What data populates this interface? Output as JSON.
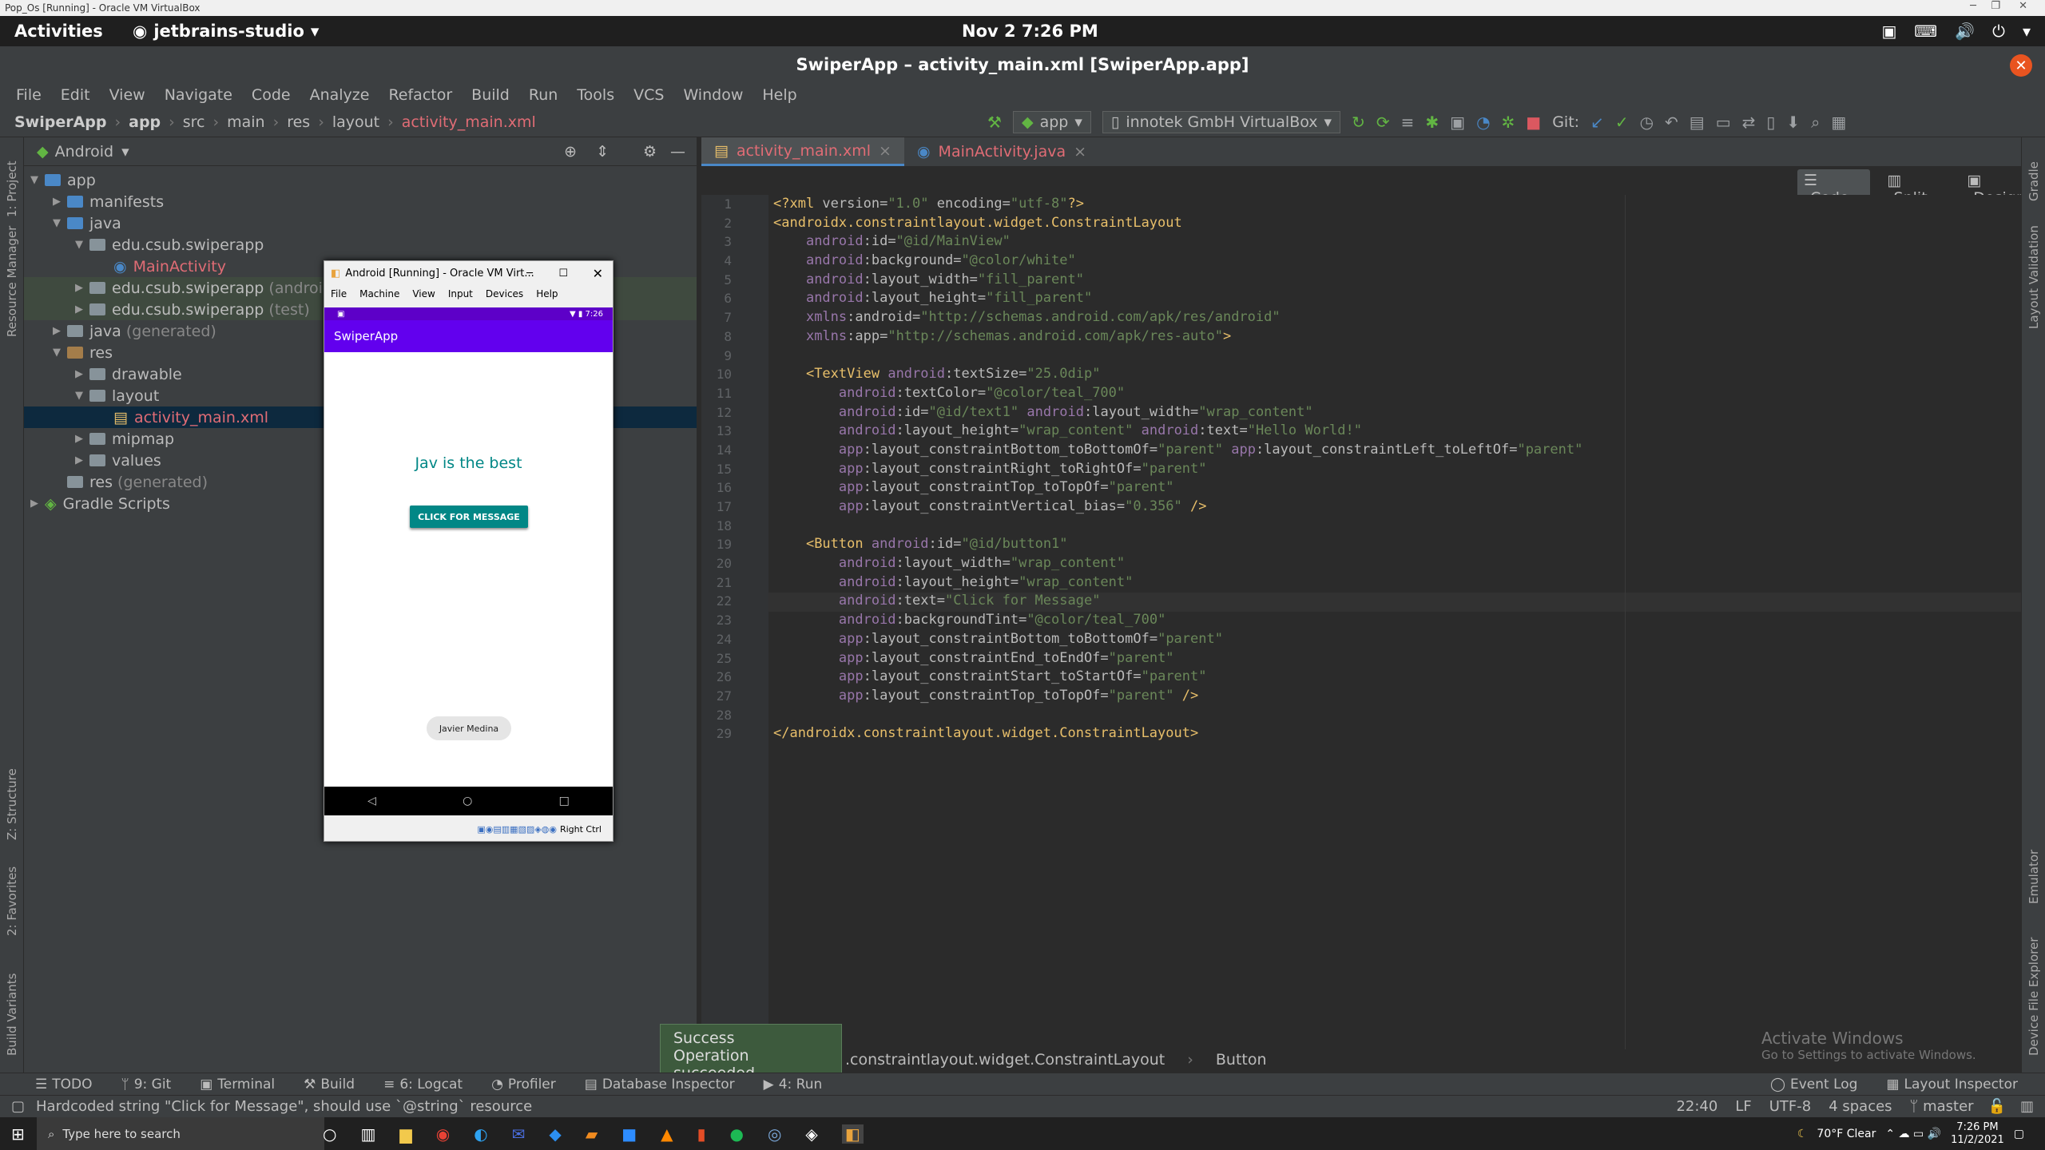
{
  "vbox": {
    "title": "Pop_Os [Running] - Oracle VM VirtualBox"
  },
  "topbar": {
    "activities": "Activities",
    "app": "jetbrains-studio",
    "clock": "Nov 2  7:26 PM"
  },
  "ide": {
    "title": "SwiperApp – activity_main.xml [SwiperApp.app]"
  },
  "menu": [
    "File",
    "Edit",
    "View",
    "Navigate",
    "Code",
    "Analyze",
    "Refactor",
    "Build",
    "Run",
    "Tools",
    "VCS",
    "Window",
    "Help"
  ],
  "breadcrumb": [
    "SwiperApp",
    "app",
    "src",
    "main",
    "res",
    "layout",
    "activity_main.xml"
  ],
  "toolbar": {
    "config": "app",
    "device": "innotek GmbH VirtualBox",
    "git": "Git:"
  },
  "leftstrip": [
    "1: Project",
    "Resource Manager",
    "Z: Structure",
    "2: Favorites",
    "Build Variants"
  ],
  "rightstrip": [
    "Gradle",
    "Layout Validation",
    "Emulator",
    "Device File Explorer"
  ],
  "project": {
    "view": "Android",
    "tree": [
      {
        "label": "app",
        "depth": 0
      },
      {
        "label": "manifests",
        "depth": 1
      },
      {
        "label": "java",
        "depth": 1
      },
      {
        "label": "edu.csub.swiperapp",
        "depth": 2
      },
      {
        "label": "MainActivity",
        "depth": 3
      },
      {
        "label": "edu.csub.swiperapp",
        "suffix": "(androidTest)",
        "depth": 2
      },
      {
        "label": "edu.csub.swiperapp",
        "suffix": "(test)",
        "depth": 2
      },
      {
        "label": "java",
        "suffix": "(generated)",
        "depth": 1
      },
      {
        "label": "res",
        "depth": 1
      },
      {
        "label": "drawable",
        "depth": 2
      },
      {
        "label": "layout",
        "depth": 2
      },
      {
        "label": "activity_main.xml",
        "depth": 3
      },
      {
        "label": "mipmap",
        "depth": 2
      },
      {
        "label": "values",
        "depth": 2
      },
      {
        "label": "res",
        "suffix": "(generated)",
        "depth": 1
      },
      {
        "label": "Gradle Scripts",
        "depth": 0
      }
    ]
  },
  "vm": {
    "title": "Android [Running] - Oracle VM Virt...",
    "menu": [
      "File",
      "Machine",
      "View",
      "Input",
      "Devices",
      "Help"
    ],
    "time": "7:26",
    "app_title": "SwiperApp",
    "text": "Jav is the best",
    "button": "CLICK FOR MESSAGE",
    "chip": "Javier Medina",
    "host_key": "Right Ctrl"
  },
  "tabs": [
    {
      "label": "activity_main.xml"
    },
    {
      "label": "MainActivity.java"
    }
  ],
  "modes": [
    "Code",
    "Split",
    "Design"
  ],
  "lines": [
    "1",
    "2",
    "3",
    "4",
    "5",
    "6",
    "7",
    "8",
    "9",
    "10",
    "11",
    "12",
    "13",
    "14",
    "15",
    "16",
    "17",
    "18",
    "19",
    "20",
    "21",
    "22",
    "23",
    "24",
    "25",
    "26",
    "27",
    "28",
    "29"
  ],
  "code": [
    "<?xml version=\"1.0\" encoding=\"utf-8\"?>",
    "<androidx.constraintlayout.widget.ConstraintLayout",
    "    android:id=\"@id/MainView\"",
    "    android:background=\"@color/white\"",
    "    android:layout_width=\"fill_parent\"",
    "    android:layout_height=\"fill_parent\"",
    "    xmlns:android=\"http://schemas.android.com/apk/res/android\"",
    "    xmlns:app=\"http://schemas.android.com/apk/res-auto\">",
    "",
    "    <TextView android:textSize=\"25.0dip\"",
    "        android:textColor=\"@color/teal_700\"",
    "        android:id=\"@id/text1\" android:layout_width=\"wrap_content\"",
    "        android:layout_height=\"wrap_content\" android:text=\"Hello World!\"",
    "        app:layout_constraintBottom_toBottomOf=\"parent\" app:layout_constraintLeft_toLeftOf=\"parent\"",
    "        app:layout_constraintRight_toRightOf=\"parent\"",
    "        app:layout_constraintTop_toTopOf=\"parent\"",
    "        app:layout_constraintVertical_bias=\"0.356\" />",
    "",
    "    <Button android:id=\"@id/button1\"",
    "        android:layout_width=\"wrap_content\"",
    "        android:layout_height=\"wrap_content\"",
    "        android:text=\"Click for Message\"",
    "        android:backgroundTint=\"@color/teal_700\"",
    "        app:layout_constraintBottom_toBottomOf=\"parent\"",
    "        app:layout_constraintEnd_toEndOf=\"parent\"",
    "        app:layout_constraintStart_toStartOf=\"parent\"",
    "        app:layout_constraintTop_toTopOf=\"parent\" />",
    "",
    "</androidx.constraintlayout.widget.ConstraintLayout>"
  ],
  "editor_crumb": [
    ".constraintlayout.widget.ConstraintLayout",
    "Button"
  ],
  "toast": {
    "title": "Success",
    "msg": "Operation succeeded"
  },
  "watermark": {
    "title": "Activate Windows",
    "sub": "Go to Settings to activate Windows."
  },
  "bottomtabs": [
    "TODO",
    "9: Git",
    "Terminal",
    "Build",
    "6: Logcat",
    "Profiler",
    "Database Inspector",
    "4: Run"
  ],
  "bottomright": [
    "Event Log",
    "Layout Inspector"
  ],
  "status": {
    "message": "Hardcoded string \"Click for Message\", should use `@string` resource",
    "pos": "22:40",
    "lf": "LF",
    "enc": "UTF-8",
    "indent": "4 spaces",
    "branch": "master"
  },
  "taskbar": {
    "search": "Type here to search",
    "weather": "70°F  Clear",
    "time": "7:26 PM",
    "date": "11/2/2021"
  }
}
